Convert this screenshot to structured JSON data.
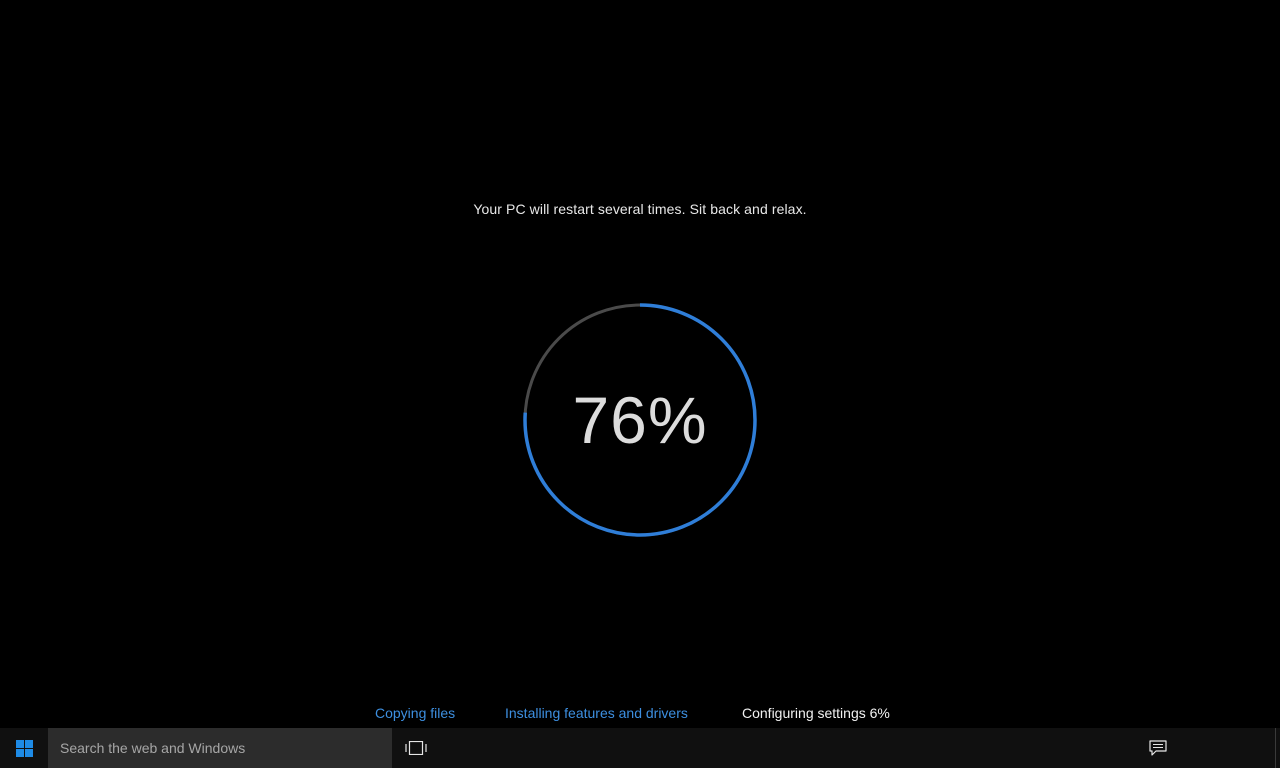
{
  "setup": {
    "message": "Your PC will restart several times. Sit back and relax.",
    "progress_text": "76%",
    "progress_fraction": 0.76,
    "ring_colors": {
      "complete": "#2f7ed8",
      "remaining": "#4a4a4a"
    },
    "stages": [
      {
        "label": "Copying files",
        "status": "done"
      },
      {
        "label": "Installing features and drivers",
        "status": "done"
      },
      {
        "label": "Configuring settings 6%",
        "status": "current"
      }
    ],
    "stage_colors": {
      "done": "#3d8fe0",
      "current": "#f2f2f2"
    }
  },
  "taskbar": {
    "start_icon": "windows-logo-icon",
    "search_placeholder": "Search the web and Windows",
    "task_view_icon": "task-view-icon",
    "action_center_icon": "action-center-icon"
  }
}
